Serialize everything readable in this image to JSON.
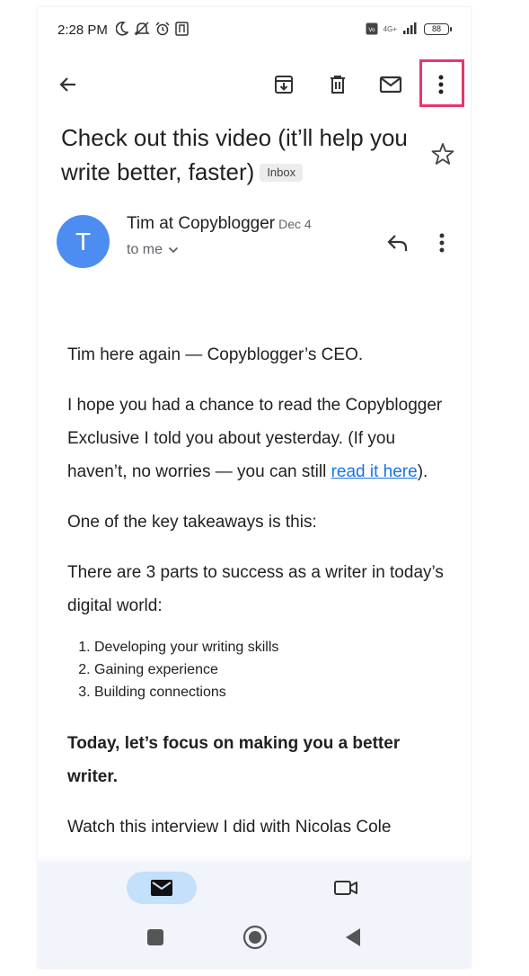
{
  "status_bar": {
    "time": "2:28 PM",
    "network": "4G+",
    "battery": "88"
  },
  "toolbar": {
    "icons": [
      "back-arrow-icon",
      "archive-icon",
      "delete-icon",
      "mark-unread-icon",
      "more-vert-icon"
    ],
    "highlight_color": "#e8366a"
  },
  "email": {
    "subject": "Check out this video (it’ll help you write better, faster)",
    "label": "Inbox",
    "sender_initial": "T",
    "sender_name": "Tim at Copyblogger",
    "date": "Dec 4",
    "recipient": "to me",
    "avatar_color": "#4d8df1"
  },
  "body": {
    "p1": "Tim here again — Copyblogger’s CEO.",
    "p2_before": "I hope you had a chance to read the Copyblogger Exclusive I told you about yesterday. (If you haven’t, no worries — you can still ",
    "p2_link": "read it here",
    "p2_after": ").",
    "p3": "One of the key takeaways is this:",
    "p4": "There are 3 parts to success as a writer in today’s digital world:",
    "list": [
      "Developing your writing skills",
      "Gaining experience",
      "Building connections"
    ],
    "p5": "Today, let’s focus on making you a better writer.",
    "p6_partial": "Watch this interview I did with Nicolas Cole"
  },
  "bottom_nav": {
    "items": [
      "mail-icon",
      "video-icon"
    ],
    "active_color": "#c4e0fb"
  }
}
